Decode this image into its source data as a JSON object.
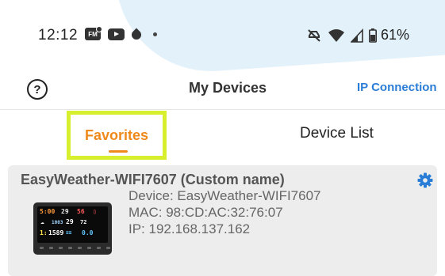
{
  "status_bar": {
    "time": "12:12",
    "fm_label": "FM",
    "battery": "61%",
    "left_icons": [
      "fm-radio-icon",
      "youtube-icon",
      "drop-icon",
      "dot-icon"
    ],
    "right_icons": [
      "mute-icon",
      "wifi-icon",
      "signal-icon",
      "battery-icon"
    ]
  },
  "header": {
    "help_symbol": "?",
    "title": "My Devices",
    "ip_connection": "IP Connection"
  },
  "tabs": {
    "favorites": "Favorites",
    "device_list": "Device List"
  },
  "device": {
    "name": "EasyWeather-WIFI7607 (Custom name)",
    "device_line": "Device: EasyWeather-WIFI7607",
    "mac_line": "MAC: 98:CD:AC:32:76:07",
    "ip_line": "IP: 192.168.137.162"
  },
  "colors": {
    "accent_orange": "#ee8a1c",
    "link_blue": "#2a7dd6",
    "highlight_yellow": "#d7ef2c",
    "card_bg": "#ededed"
  }
}
